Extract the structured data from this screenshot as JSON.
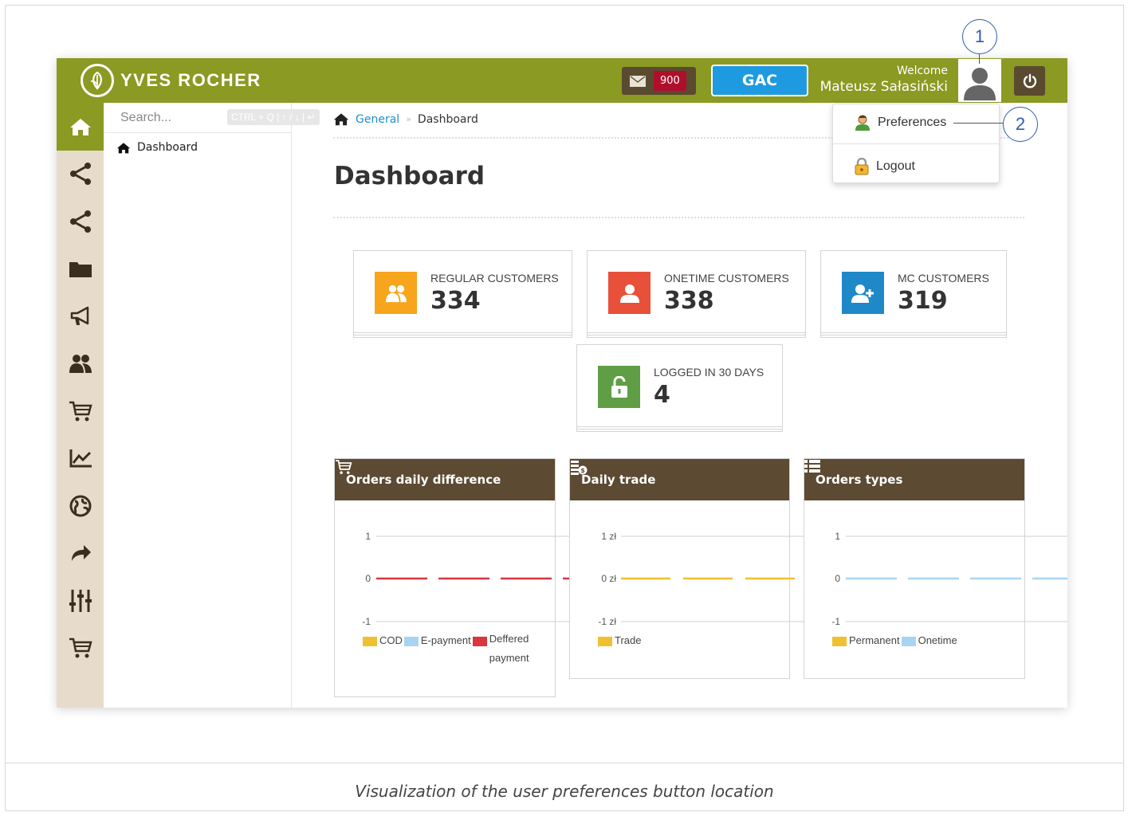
{
  "header": {
    "brand": "YVES ROCHER",
    "mail_count": "900",
    "gac_label": "GAC",
    "welcome_label": "Welcome",
    "user_name": "Mateusz Sałasiński"
  },
  "search": {
    "placeholder": "Search...",
    "shortcut_hint": "CTRL + Q | ↑ / ↓ | ↵"
  },
  "sidebar": {
    "icons": [
      "home-icon",
      "share-icon",
      "share-icon",
      "folder-icon",
      "megaphone-icon",
      "users-icon",
      "cart-icon",
      "line-chart-icon",
      "globe-icon",
      "forward-icon",
      "sliders-icon",
      "cart-icon"
    ],
    "menu_items": [
      {
        "label": "Dashboard"
      }
    ]
  },
  "breadcrumb": {
    "root": "General",
    "current": "Dashboard"
  },
  "page": {
    "title": "Dashboard"
  },
  "stats": [
    {
      "label": "REGULAR CUSTOMERS",
      "value": "334",
      "color": "#f7a51c"
    },
    {
      "label": "ONETIME CUSTOMERS",
      "value": "338",
      "color": "#e8503a"
    },
    {
      "label": "MC CUSTOMERS",
      "value": "319",
      "color": "#1e88c8"
    },
    {
      "label": "LOGGED IN 30 DAYS",
      "value": "4",
      "color": "#5f9e45"
    }
  ],
  "charts": [
    {
      "title": "Orders daily difference",
      "y_ticks": [
        "1",
        "0",
        "-1"
      ],
      "series": [
        {
          "name": "COD",
          "color": "#f0c030"
        },
        {
          "name": "E-payment",
          "color": "#a8d4f2"
        },
        {
          "name": "Deffered payment",
          "color": "#d9363e"
        }
      ]
    },
    {
      "title": "Daily trade",
      "y_ticks": [
        "1 zł",
        "0 zł",
        "-1 zł"
      ],
      "series": [
        {
          "name": "Trade",
          "color": "#f0c030"
        }
      ]
    },
    {
      "title": "Orders types",
      "y_ticks": [
        "1",
        "0",
        "-1"
      ],
      "series": [
        {
          "name": "Permanent",
          "color": "#f0c030"
        },
        {
          "name": "Onetime",
          "color": "#a8d4f2"
        }
      ]
    }
  ],
  "user_menu": {
    "preferences": "Preferences",
    "logout": "Logout"
  },
  "annotations": {
    "avatar_marker": "1",
    "preferences_marker": "2"
  },
  "caption": "Visualization of the user preferences button location"
}
